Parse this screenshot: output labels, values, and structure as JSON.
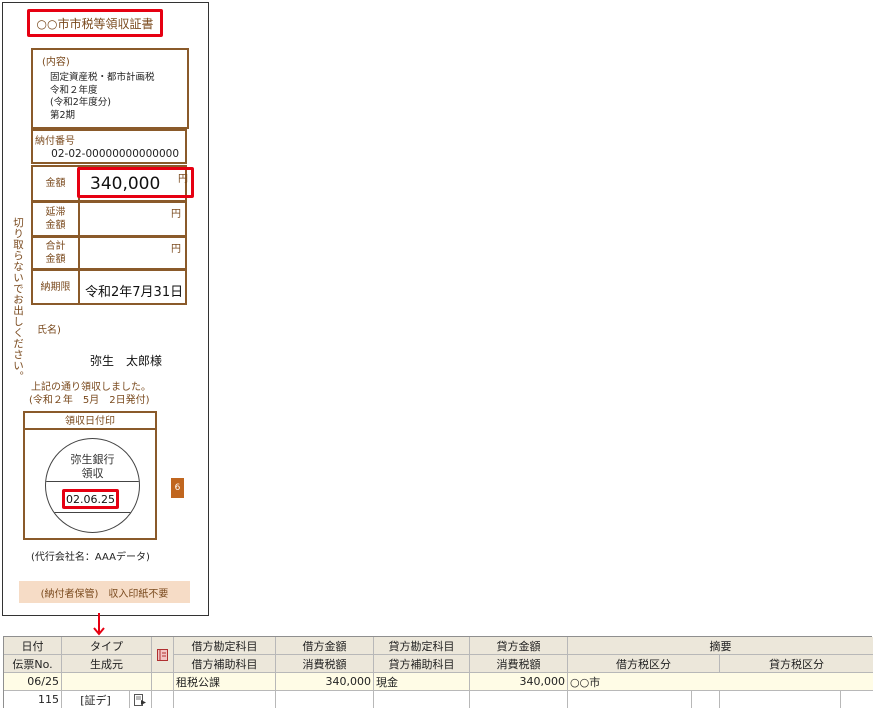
{
  "receipt": {
    "title": "○○市市税等領収証書",
    "content_label": "(内容)",
    "content_lines": [
      "固定資産税・都市計画税",
      "令和２年度",
      "(令和2年度分)",
      "第2期"
    ],
    "payment_no_label": "納付番号",
    "payment_no": "02-02-00000000000000",
    "amount_label": "金額",
    "amount": "340,000",
    "yen": "円",
    "late_fee_label": "延滞\n金額",
    "total_label": "合計\n金額",
    "due_label": "納期限",
    "due_date": "令和2年7月31日",
    "vertical_note": "切り取らないでお出しください。",
    "name_label": "氏名)",
    "name_value": "弥生　太郎様",
    "received_line1": "上記の通り領収しました。",
    "received_line2": "(令和２年　5月　2日発付)",
    "stamp_header": "領収日付印",
    "stamp_bank": "弥生銀行\n領収",
    "stamp_date": "02.06.25",
    "badge": "6",
    "agent": "(代行会社名：AAAデータ)",
    "bottom_note": "(納付者保管)　収入印紙不要"
  },
  "journal": {
    "headers_row1": [
      "日付",
      "タイプ",
      "借方勘定科目",
      "借方金額",
      "貸方勘定科目",
      "貸方金額",
      "摘要"
    ],
    "headers_row2": [
      "伝票No.",
      "生成元",
      "借方補助科目",
      "消費税額",
      "貸方補助科目",
      "消費税額",
      "借方税区分",
      "貸方税区分"
    ],
    "row": {
      "date": "06/25",
      "voucher_no": "115",
      "source": "[証デ]",
      "debit_account": "租税公課",
      "debit_amount": "340,000",
      "credit_account": "現金",
      "credit_amount": "340,000",
      "memo": "○○市"
    },
    "colors": {
      "header_bg": "#ece7da",
      "highlight": "#e60012",
      "brown": "#8a5a2a"
    }
  }
}
